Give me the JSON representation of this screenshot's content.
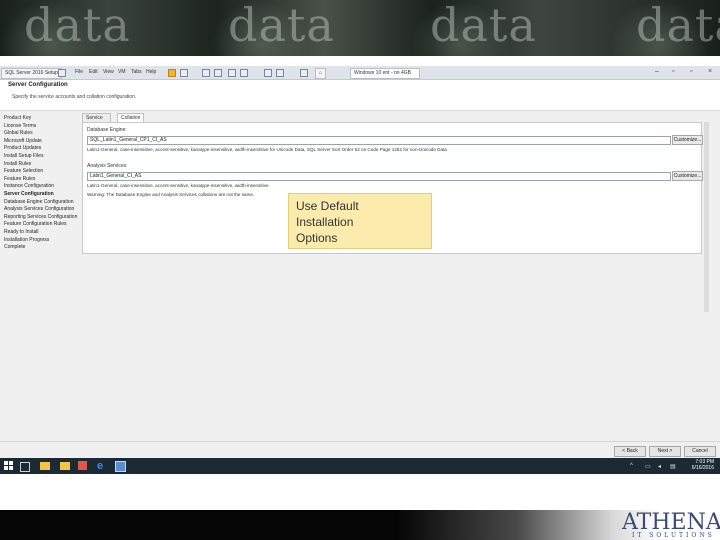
{
  "banner": {
    "word": "data"
  },
  "window": {
    "tabs": [
      {
        "label": "SQL Server 2016 Setup"
      },
      {
        "label": "Windows 10 ent - no 4GB"
      }
    ],
    "menu": [
      "File",
      "Edit",
      "View",
      "VM",
      "Tabs",
      "Help"
    ],
    "header": {
      "title": "Server Configuration",
      "subtitle": "Specify the service accounts and collation configuration."
    },
    "nav": [
      "Product Key",
      "License Terms",
      "Global Rules",
      "Microsoft Update",
      "Product Updates",
      "Install Setup Files",
      "Install Rules",
      "Feature Selection",
      "Feature Rules",
      "Instance Configuration",
      "Server Configuration",
      "Database Engine Configuration",
      "Analysis Services Configuration",
      "Reporting Services Configuration",
      "Feature Configuration Rules",
      "Ready to Install",
      "Installation Progress",
      "Complete"
    ],
    "current_nav": "Server Configuration",
    "content_tabs": [
      "Service Accounts",
      "Collation"
    ],
    "active_tab": "Collation",
    "db_engine": {
      "section": "Database Engine:",
      "value": "SQL_Latin1_General_CP1_CI_AS",
      "customize": "Customize...",
      "description": "Latin1-General, case-insensitive, accent-sensitive, kanatype-insensitive, width-insensitive for Unicode Data, SQL Server Sort Order 52 on Code Page 1252 for non-Unicode Data"
    },
    "analysis": {
      "section": "Analysis Services:",
      "value": "Latin1_General_CI_AS",
      "customize": "Customize...",
      "description": "Latin1-General, case-insensitive, accent-sensitive, kanatype-insensitive, width-insensitive",
      "warning": "Warning: The Database Engine and Analysis Services collations are not the same."
    },
    "buttons": {
      "back": "< Back",
      "next": "Next >",
      "cancel": "Cancel"
    },
    "clock": {
      "time": "7:03 PM",
      "date": "6/16/2016"
    }
  },
  "callout": {
    "text": [
      "Use Default",
      "Installation",
      "Options"
    ]
  },
  "logo": {
    "word": "ATHENA",
    "sub": "IT SOLUTIONS",
    "color": "#3a4a74"
  }
}
